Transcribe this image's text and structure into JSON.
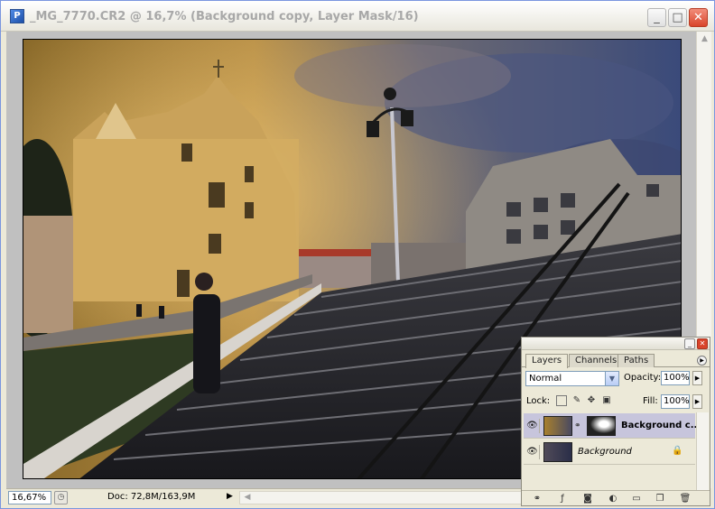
{
  "window": {
    "title": "_MG_7770.CR2 @ 16,7% (Background copy, Layer Mask/16)",
    "minimize_label": "_",
    "maximize_label": "□",
    "close_label": "✕"
  },
  "status": {
    "zoom": "16,67%",
    "doc": "Doc: 72,8M/163,9M"
  },
  "layers_panel": {
    "tabs": [
      "Layers",
      "Channels",
      "Paths"
    ],
    "active_tab": "Layers",
    "blend_mode": "Normal",
    "opacity_label": "Opacity:",
    "opacity": "100%",
    "lock_label": "Lock:",
    "fill_label": "Fill:",
    "fill": "100%",
    "layers": [
      {
        "name": "Background c...",
        "selected": true,
        "has_mask": true
      },
      {
        "name": "Background",
        "selected": false,
        "locked": true
      }
    ]
  },
  "colors": {
    "selection": "#c7c5dc",
    "close_button": "#d9442b"
  }
}
